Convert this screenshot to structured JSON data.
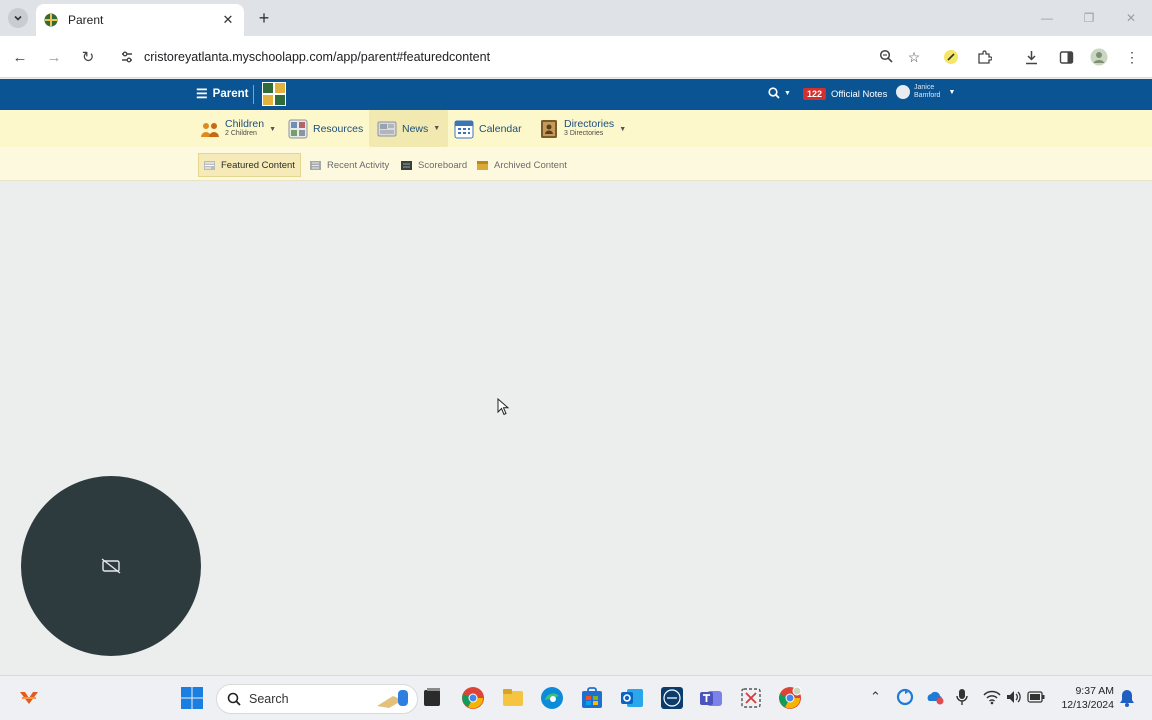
{
  "browser": {
    "tab_title": "Parent",
    "url": "cristoreyatlanta.myschoolapp.com/app/parent#featuredcontent"
  },
  "app_nav": {
    "menu_label": "Parent",
    "notes_count": "122",
    "notes_label": "Official Notes",
    "user_first": "Janice",
    "user_last": "Bamford"
  },
  "menu": {
    "children_label": "Children",
    "children_sub": "2 Children",
    "resources_label": "Resources",
    "news_label": "News",
    "calendar_label": "Calendar",
    "directories_label": "Directories",
    "directories_sub": "3 Directories"
  },
  "submenu": {
    "featured": "Featured Content",
    "recent": "Recent Activity",
    "scoreboard": "Scoreboard",
    "archived": "Archived Content"
  },
  "taskbar": {
    "search_label": "Search",
    "time": "9:37 AM",
    "date": "12/13/2024"
  },
  "colors": {
    "app_bar": "#0b5493",
    "menu_bar": "#fdf8cc",
    "notes_badge": "#d32f2f"
  }
}
